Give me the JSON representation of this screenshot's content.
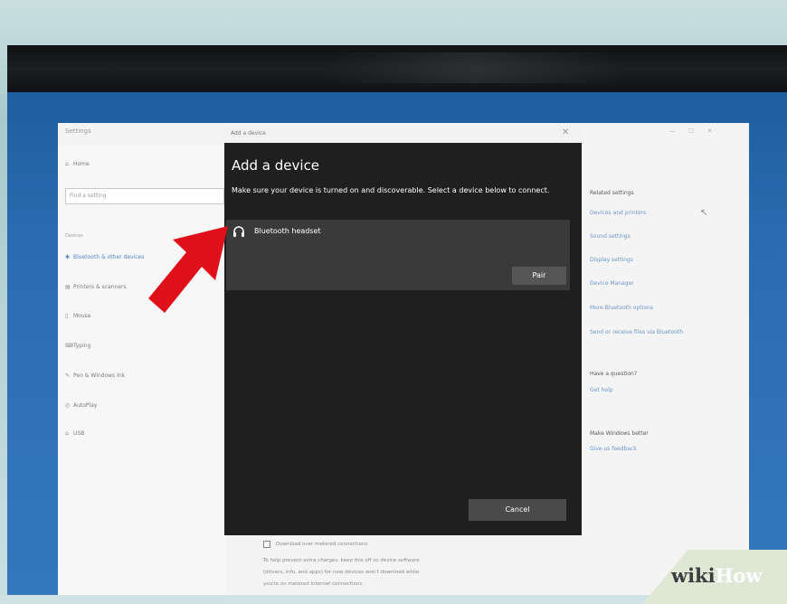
{
  "settings": {
    "title": "Settings",
    "window_controls": "—  ☐  ✕",
    "search_placeholder": "Find a setting",
    "nav_home": "Home",
    "section_label": "Devices",
    "nav_items": [
      {
        "icon": "bluetooth-icon",
        "glyph": "✱",
        "label": "Bluetooth & other devices",
        "active": true
      },
      {
        "icon": "printer-icon",
        "glyph": "▤",
        "label": "Printers & scanners",
        "active": false
      },
      {
        "icon": "mouse-icon",
        "glyph": "▯",
        "label": "Mouse",
        "active": false
      },
      {
        "icon": "keyboard-icon",
        "glyph": "⌨",
        "label": "Typing",
        "active": false
      },
      {
        "icon": "pen-icon",
        "glyph": "✎",
        "label": "Pen & Windows Ink",
        "active": false
      },
      {
        "icon": "autoplay-icon",
        "glyph": "◴",
        "label": "AutoPlay",
        "active": false
      },
      {
        "icon": "usb-icon",
        "glyph": "⌂",
        "label": "USB",
        "active": false
      }
    ],
    "right_panel": {
      "related_heading": "Related settings",
      "related_links": [
        "Devices and printers",
        "Sound settings",
        "Display settings",
        "Device Manager",
        "More Bluetooth options",
        "Send or receive files via Bluetooth"
      ],
      "question_heading": "Have a question?",
      "question_link": "Get help",
      "better_heading": "Make Windows better",
      "better_link": "Give us feedback"
    },
    "bottom_checkbox_label": "Download over metered connections",
    "bottom_text": [
      "To help prevent extra charges, keep this off so device software",
      "(drivers, info, and apps) for new devices won't download while",
      "you're on metered Internet connections."
    ]
  },
  "dialog": {
    "titlebar": "Add a device",
    "close_glyph": "✕",
    "heading": "Add a device",
    "description": "Make sure your device is turned on and discoverable. Select a device below to connect.",
    "device": {
      "icon": "headphones-icon",
      "name": "Bluetooth headset"
    },
    "pair_label": "Pair",
    "cancel_label": "Cancel"
  },
  "watermark": {
    "wiki": "wiki",
    "how": "How"
  },
  "colors": {
    "dialog_bg": "#1f1f1f",
    "device_row_bg": "#3a3a3a",
    "accent_blue": "#4f86c6",
    "arrow_red": "#e0101b",
    "desktop_blue": "#2b6cb0"
  }
}
